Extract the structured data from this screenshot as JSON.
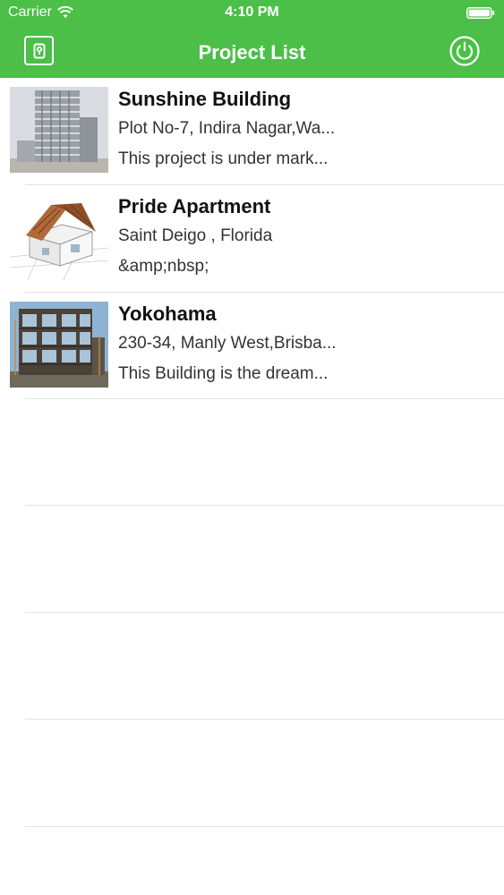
{
  "status_bar": {
    "carrier": "Carrier",
    "time": "4:10 PM",
    "icons": [
      "wifi-icon",
      "battery-icon"
    ]
  },
  "nav": {
    "title": "Project List",
    "left_icon": "keyhole-icon",
    "right_icon": "power-icon"
  },
  "colors": {
    "header_bg": "#4bbf48",
    "header_text": "#ffffff",
    "separator": "#e2e2e2"
  },
  "projects": [
    {
      "title": "Sunshine Building",
      "address": "Plot No-7, Indira Nagar,Wa...",
      "description": "This project is under mark...",
      "thumbnail": "building-under-construction"
    },
    {
      "title": "Pride Apartment",
      "address": "Saint Deigo , Florida",
      "description": "&amp;nbsp;",
      "thumbnail": "house-model-on-blueprint"
    },
    {
      "title": "Yokohama",
      "address": "230-34, Manly West,Brisba...",
      "description": "This Building is the dream...",
      "thumbnail": "building-frame-under-construction"
    }
  ]
}
